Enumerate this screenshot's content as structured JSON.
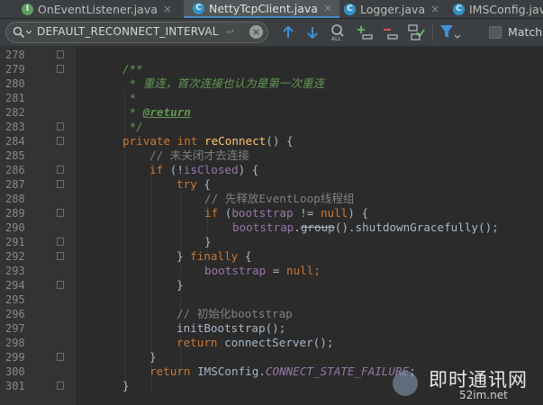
{
  "tabs": [
    {
      "label": "OnEventListener.java",
      "icon": "I",
      "active": false
    },
    {
      "label": "NettyTcpClient.java",
      "icon": "C",
      "active": true
    },
    {
      "label": "Logger.java",
      "icon": "C",
      "active": false
    },
    {
      "label": "IMSConfig.java",
      "icon": "C",
      "active": false
    }
  ],
  "search": {
    "value": "DEFAULT_RECONNECT_INTERVAL",
    "match_label": "Match"
  },
  "code": {
    "line_numbers": [
      "278",
      "279",
      "280",
      "281",
      "282",
      "283",
      "284",
      "285",
      "286",
      "287",
      "288",
      "289",
      "290",
      "291",
      "292",
      "293",
      "294",
      "295",
      "296",
      "297",
      "298",
      "299",
      "300",
      "301"
    ],
    "l279": "/**",
    "l280": " * 重连，首次连接也认为是第一次重连",
    "l281": " *",
    "l282_star": " * ",
    "l282_tag": "@return",
    "l283": " */",
    "private": "private",
    "int": "int",
    "method_name": "reConnect",
    "l284_rest": "() {",
    "l285": "// 未关闭才去连接",
    "if": "if",
    "l286_a": " (!",
    "isClosed": "isClosed",
    "l286_b": ") {",
    "try": "try",
    "l287_rest": " {",
    "l288": "// 先释放EventLoop线程组",
    "l289_a": " (",
    "bootstrap": "bootstrap",
    "l289_b": " != ",
    "null": "null",
    "l289_c": ") {",
    "l290_dot": ".",
    "group": "group",
    "l290_rest": "().shutdownGracefully();",
    "close_brace": "}",
    "l292_a": "} ",
    "finally": "finally",
    "l292_b": " {",
    "l293_eq": " = ",
    "semicolon": ";",
    "l296": "// 初始化bootstrap",
    "l297": "initBootstrap();",
    "return": "return",
    "l298_rest": " connectServer();",
    "l300_a": " IMSConfig.",
    "const": "CONNECT_STATE_FAILURE",
    "l300_b": ";"
  },
  "watermark": {
    "title": "即时通讯网",
    "url": "52im.net"
  },
  "colors": {
    "keyword": "#cc7832",
    "comment": "#808080",
    "doc": "#629755",
    "method": "#ffc66d",
    "field": "#9876aa",
    "text": "#a9b7c6",
    "background": "#2b2b2b"
  }
}
